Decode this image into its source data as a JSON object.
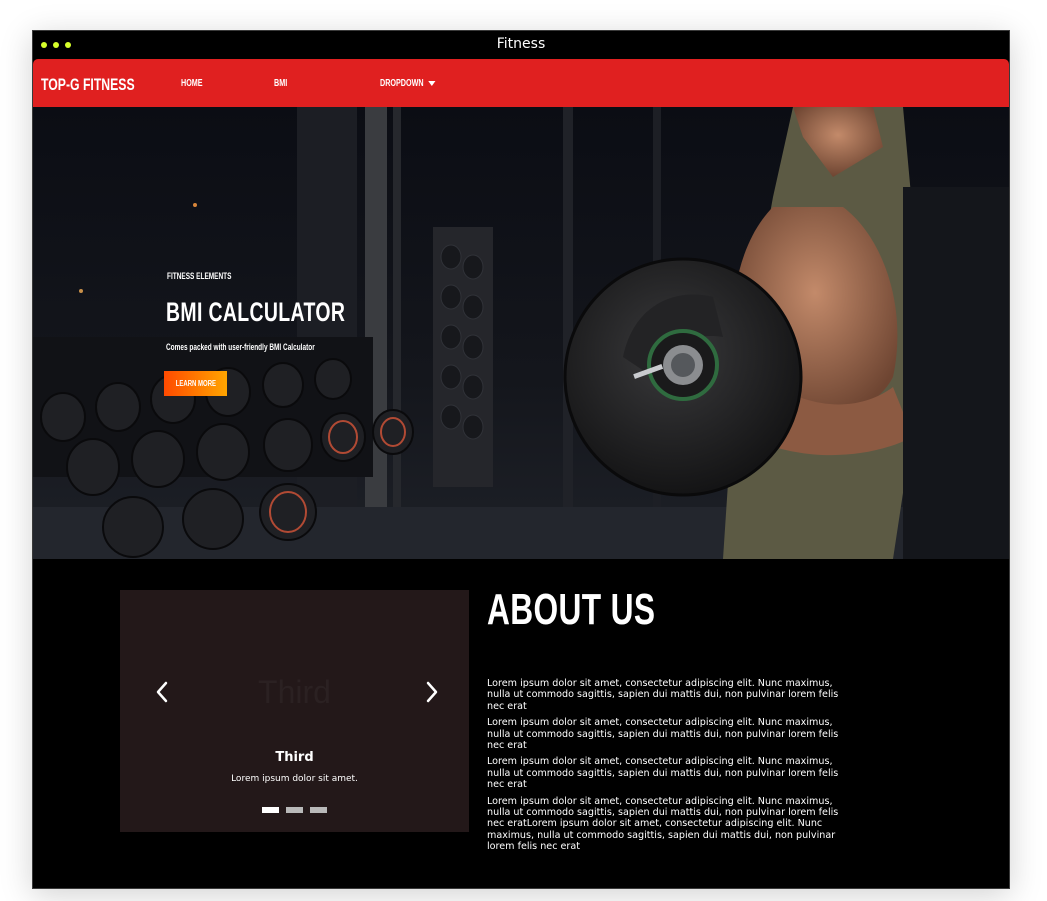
{
  "window": {
    "title": "Fitness"
  },
  "navbar": {
    "brand": "TOP-G FITNESS",
    "items": [
      {
        "label": "HOME"
      },
      {
        "label": "BMI"
      },
      {
        "label": "DROPDOWN"
      }
    ]
  },
  "hero": {
    "kicker": "FITNESS ELEMENTS",
    "title": "BMI CALCULATOR",
    "subtitle": "Comes packed with user-friendly BMI Calculator",
    "button_label": "LEARN MORE"
  },
  "carousel": {
    "ghost_label": "Third",
    "caption_title": "Third",
    "caption_text": "Lorem ipsum dolor sit amet.",
    "indicators": 3,
    "active_index": 0
  },
  "about": {
    "title": "ABOUT US",
    "paragraphs": [
      "Lorem ipsum dolor sit amet, consectetur adipiscing elit. Nunc maximus, nulla ut commodo sagittis, sapien dui mattis dui, non pulvinar lorem felis nec erat",
      "Lorem ipsum dolor sit amet, consectetur adipiscing elit. Nunc maximus, nulla ut commodo sagittis, sapien dui mattis dui, non pulvinar lorem felis nec erat",
      "Lorem ipsum dolor sit amet, consectetur adipiscing elit. Nunc maximus, nulla ut commodo sagittis, sapien dui mattis dui, non pulvinar lorem felis nec erat",
      "Lorem ipsum dolor sit amet, consectetur adipiscing elit. Nunc maximus, nulla ut commodo sagittis, sapien dui mattis dui, non pulvinar lorem felis nec eratLorem ipsum dolor sit amet, consectetur adipiscing elit. Nunc maximus, nulla ut commodo sagittis, sapien dui mattis dui, non pulvinar lorem felis nec erat"
    ]
  },
  "colors": {
    "navbar": "#e02020",
    "button_gradient_start": "#ff4a00",
    "button_gradient_end": "#ffa500",
    "window_dots": "#d7ff2b",
    "carousel_bg": "#231819"
  },
  "icons": {
    "dropdown": "caret-down-icon",
    "carousel_prev": "chevron-left-icon",
    "carousel_next": "chevron-right-icon"
  }
}
